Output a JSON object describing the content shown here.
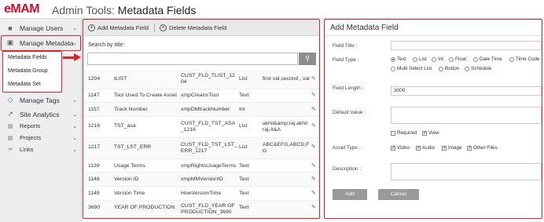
{
  "app": {
    "logo": "eMAM",
    "title_prefix": "Admin Tools:",
    "title": "Metadata Fields"
  },
  "sidebar": {
    "items": [
      {
        "label": "Manage Users",
        "icon": "users-icon"
      },
      {
        "label": "Manage Metadata",
        "icon": "metadata-icon"
      },
      {
        "label": "Manage Tags",
        "icon": "tag-icon"
      },
      {
        "label": "Site Analytics",
        "icon": "analytics-icon"
      },
      {
        "label": "Reports",
        "icon": "reports-icon"
      },
      {
        "label": "Projects",
        "icon": "projects-icon"
      },
      {
        "label": "Links",
        "icon": "links-icon"
      }
    ],
    "submenu": [
      "Metadata Fields",
      "Metadata Group",
      "Metadata Set"
    ]
  },
  "toolbar": {
    "add_label": "Add Metadata Field",
    "delete_label": "Delete Metadata Field"
  },
  "search": {
    "label": "Search by title:",
    "placeholder": ""
  },
  "table": {
    "rows": [
      {
        "id": "1204",
        "title": "tLIST",
        "name": "CUST_FLD_TLIST_1204",
        "type": "List",
        "values": "first val,second , val"
      },
      {
        "id": "1147",
        "title": "Tool Used To Create Asset",
        "name": "xmpCreatorTool",
        "type": "Text",
        "values": ""
      },
      {
        "id": "1157",
        "title": "Track Number",
        "name": "xmpDMtrackNumber",
        "type": "Int",
        "values": ""
      },
      {
        "id": "1216",
        "title": "TST_asa",
        "name": "CUST_FLD_TST_ASA_1216",
        "type": "List",
        "values": "akhil&amp;raj,akhil raj,A&A"
      },
      {
        "id": "1217",
        "title": "TST_LST_ERR",
        "name": "CUST_FLD_TST_LST_ERR_1217",
        "type": "List",
        "values": "ABC&EFG,ABCD,FG"
      },
      {
        "id": "1139",
        "title": "Usage Terms",
        "name": "xmpRightsUsageTerms",
        "type": "Text",
        "values": ""
      },
      {
        "id": "1148",
        "title": "Version ID",
        "name": "xmpMMVersionID",
        "type": "Text",
        "values": ""
      },
      {
        "id": "1149",
        "title": "Version Time",
        "name": "HowVersionTime",
        "type": "Text",
        "values": ""
      },
      {
        "id": "3690",
        "title": "YEAR OF PRODUCTION",
        "name": "CUST_FLD_YEAR OF PRODUCTION_3690",
        "type": "Text",
        "values": ""
      }
    ]
  },
  "form": {
    "heading": "Add Metadata Field",
    "field_title_label": "Field Title :",
    "field_title_value": "",
    "field_type_label": "Field Type :",
    "field_types": [
      "Text",
      "List",
      "Int",
      "Float",
      "Date Time",
      "Time Code",
      "Multi Select List",
      "Button",
      "Schedule"
    ],
    "selected_type": "Text",
    "field_length_label": "Field Length :",
    "field_length_value": "3000",
    "default_value_label": "Default Value :",
    "default_value": "",
    "required_label": "Required",
    "view_label": "View",
    "asset_type_label": "Asset Type :",
    "asset_types": [
      "Video",
      "Audio",
      "Image",
      "Other Files"
    ],
    "description_label": "Description :",
    "description_value": "",
    "add_button": "Add",
    "cancel_button": "Cancel"
  },
  "colors": {
    "highlight": "#e0202a",
    "logo": "#c8102e"
  }
}
